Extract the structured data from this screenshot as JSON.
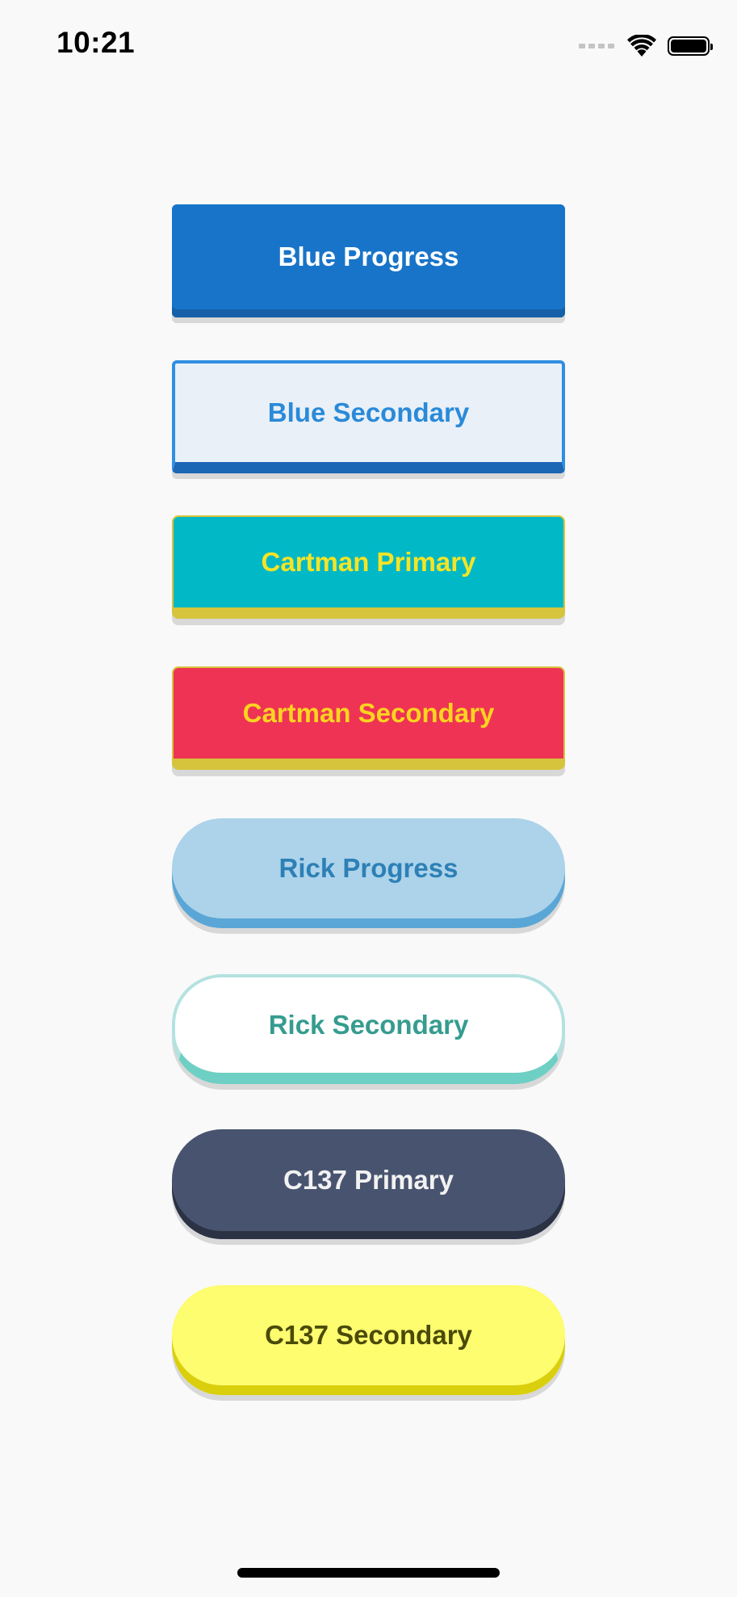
{
  "status_bar": {
    "time": "10:21",
    "icons": [
      "cellular-signal-icon",
      "wifi-icon",
      "battery-icon"
    ]
  },
  "buttons": [
    {
      "label": "Blue Progress",
      "colors": {
        "fill": "#1874c9",
        "text": "#ffffff",
        "base": "#1560a8"
      }
    },
    {
      "label": "Blue Secondary",
      "colors": {
        "fill": "#e9f0f8",
        "text": "#2a8ad8",
        "border": "#2f8fe0",
        "base": "#1c66b6"
      }
    },
    {
      "label": "Cartman Primary",
      "colors": {
        "fill": "#00b8c6",
        "text": "#f4e426",
        "base": "#d6c43c"
      }
    },
    {
      "label": "Cartman Secondary",
      "colors": {
        "fill": "#ef3354",
        "text": "#fbd420",
        "base": "#d6c43c"
      }
    },
    {
      "label": "Rick Progress",
      "colors": {
        "fill": "#acd3ea",
        "text": "#2d80b6",
        "base": "#5aa6d6"
      }
    },
    {
      "label": "Rick Secondary",
      "colors": {
        "fill": "#ffffff",
        "text": "#359c8f",
        "border": "#b4e2e0",
        "base": "#6ecfc4"
      }
    },
    {
      "label": "C137 Primary",
      "colors": {
        "fill": "#48546f",
        "text": "#f2f2f2",
        "base": "#2b3244"
      }
    },
    {
      "label": "C137 Secondary",
      "colors": {
        "fill": "#fefc6f",
        "text": "#4a4a08",
        "base": "#d9cf0c"
      }
    }
  ]
}
